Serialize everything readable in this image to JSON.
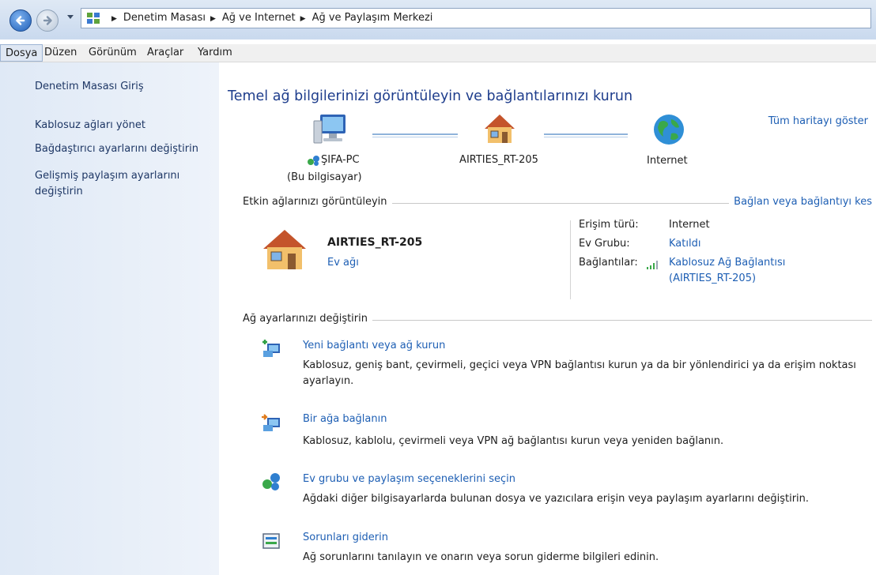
{
  "breadcrumb": {
    "items": [
      "Denetim Masası",
      "Ağ ve Internet",
      "Ağ ve Paylaşım Merkezi"
    ]
  },
  "menu": [
    "Dosya",
    "Düzen",
    "Görünüm",
    "Araçlar",
    "Yardım"
  ],
  "sidebar": {
    "items": [
      {
        "label": "Denetim Masası Giriş"
      },
      {
        "label": "Kablosuz ağları yönet"
      },
      {
        "label": "Bağdaştırıcı ayarlarını değiştirin"
      },
      {
        "label": "Gelişmiş paylaşım ayarlarını değiştirin"
      }
    ]
  },
  "main": {
    "title": "Temel ağ bilgilerinizi görüntüleyin ve bağlantılarınızı kurun",
    "full_map_link": "Tüm haritayı göster",
    "map": {
      "computer_name": "ŞIFA-PC",
      "computer_sub": "(Bu bilgisayar)",
      "router_name": "AIRTIES_RT-205",
      "internet_label": "Internet"
    },
    "active_section": {
      "heading": "Etkin ağlarınızı görüntüleyin",
      "connect_link": "Bağlan veya bağlantıyı kes",
      "network_name": "AIRTIES_RT-205",
      "network_type": "Ev ağı",
      "access_type_label": "Erişim türü:",
      "access_type_value": "Internet",
      "homegroup_label": "Ev Grubu:",
      "homegroup_value": "Katıldı",
      "connections_label": "Bağlantılar:",
      "connections_value_1": "Kablosuz Ağ Bağlantısı",
      "connections_value_2": "(AIRTIES_RT-205)"
    },
    "change_section": {
      "heading": "Ağ ayarlarınızı değiştirin",
      "tasks": [
        {
          "title": "Yeni bağlantı veya ağ kurun",
          "desc": "Kablosuz, geniş bant, çevirmeli, geçici veya VPN bağlantısı kurun ya da bir yönlendirici ya da erişim noktası ayarlayın."
        },
        {
          "title": "Bir ağa bağlanın",
          "desc": "Kablosuz, kablolu, çevirmeli veya VPN ağ bağlantısı kurun veya yeniden bağlanın."
        },
        {
          "title": "Ev grubu ve paylaşım seçeneklerini seçin",
          "desc": "Ağdaki diğer bilgisayarlarda bulunan dosya ve yazıcılara erişin veya paylaşım ayarlarını değiştirin."
        },
        {
          "title": "Sorunları giderin",
          "desc": "Ağ sorunlarını tanılayın ve onarın veya sorun giderme bilgileri edinin."
        }
      ]
    }
  },
  "icons": {
    "back": "back-arrow-icon",
    "forward": "forward-arrow-icon",
    "computer": "computer-icon",
    "house": "house-icon",
    "globe": "globe-icon",
    "signal": "signal-bars-icon"
  },
  "colors": {
    "link": "#1e5fb4",
    "title": "#1e3d8c",
    "sidebar": "#dfe9f6"
  }
}
